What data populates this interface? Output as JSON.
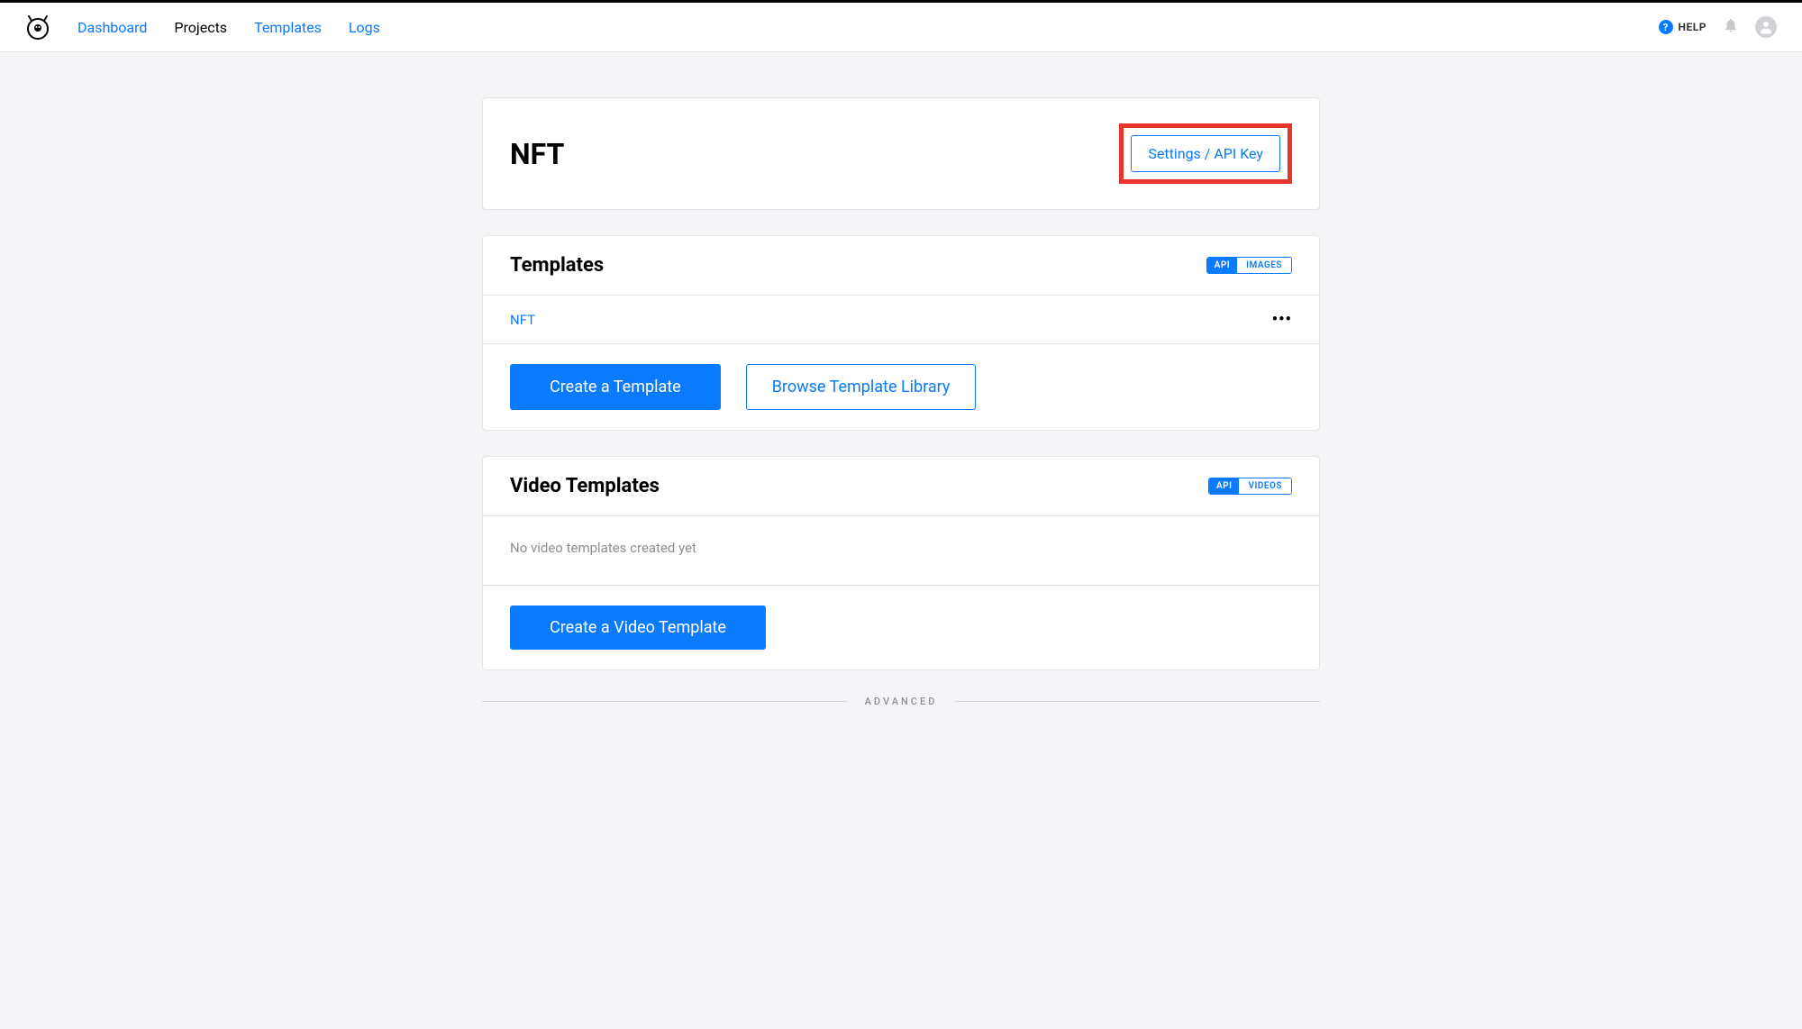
{
  "nav": {
    "items": [
      {
        "label": "Dashboard",
        "active": false
      },
      {
        "label": "Projects",
        "active": true
      },
      {
        "label": "Templates",
        "active": false
      },
      {
        "label": "Logs",
        "active": false
      }
    ]
  },
  "header": {
    "help_label": "HELP"
  },
  "project": {
    "title": "NFT",
    "settings_button": "Settings / API Key"
  },
  "templates": {
    "title": "Templates",
    "badge_api": "API",
    "badge_type": "IMAGES",
    "items": [
      {
        "name": "NFT"
      }
    ],
    "create_button": "Create a Template",
    "browse_button": "Browse Template Library"
  },
  "video_templates": {
    "title": "Video Templates",
    "badge_api": "API",
    "badge_type": "VIDEOS",
    "empty_text": "No video templates created yet",
    "create_button": "Create a Video Template"
  },
  "advanced_label": "ADVANCED"
}
